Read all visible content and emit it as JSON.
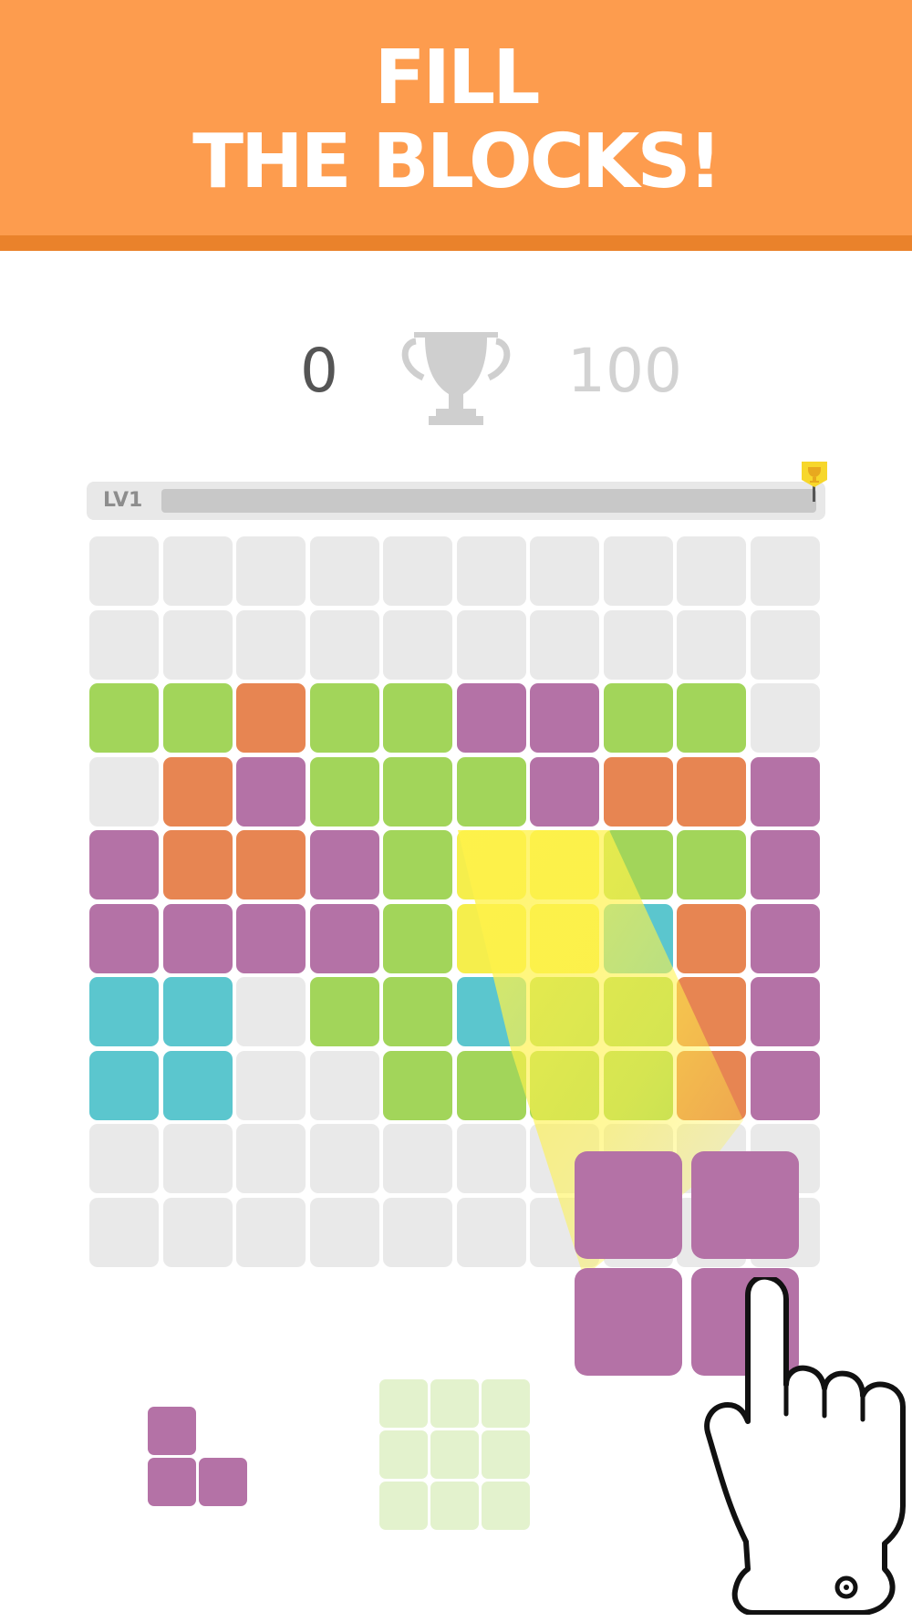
{
  "banner": {
    "title_line1": "FILL",
    "title_line2": "THE BLOCKS!",
    "background": "#fd9c4e",
    "stripe": "#ea822b"
  },
  "score": {
    "current": "0",
    "best": "100",
    "trophy_icon": "trophy-icon"
  },
  "progress": {
    "level_label": "LV1",
    "progress_fraction": 0,
    "goal_icon": "trophy-flag-icon"
  },
  "colors": {
    "empty": "#e9e9e9",
    "green": "#a2d55a",
    "orange": "#e78552",
    "purple": "#b472a6",
    "cyan": "#5bc6ce",
    "highlight": "#f5ee4c",
    "ghost_green": "#e3f2cd"
  },
  "board": {
    "columns": 10,
    "rows": 10,
    "cells": [
      [
        "E",
        "E",
        "E",
        "E",
        "E",
        "E",
        "E",
        "E",
        "E",
        "E"
      ],
      [
        "E",
        "E",
        "E",
        "E",
        "E",
        "E",
        "E",
        "E",
        "E",
        "E"
      ],
      [
        "G",
        "G",
        "O",
        "G",
        "G",
        "P",
        "P",
        "G",
        "G",
        "E"
      ],
      [
        "E",
        "O",
        "P",
        "G",
        "G",
        "G",
        "P",
        "O",
        "O",
        "P"
      ],
      [
        "P",
        "O",
        "O",
        "P",
        "G",
        "Y",
        "Y",
        "G",
        "G",
        "P"
      ],
      [
        "P",
        "P",
        "P",
        "P",
        "G",
        "Y",
        "Y",
        "C",
        "O",
        "P"
      ],
      [
        "C",
        "C",
        "E",
        "G",
        "G",
        "C",
        "G",
        "G",
        "O",
        "P"
      ],
      [
        "C",
        "C",
        "E",
        "E",
        "G",
        "G",
        "G",
        "G",
        "O",
        "P"
      ],
      [
        "E",
        "E",
        "E",
        "E",
        "E",
        "E",
        "E",
        "E",
        "E",
        "E"
      ],
      [
        "E",
        "E",
        "E",
        "E",
        "E",
        "E",
        "E",
        "E",
        "E",
        "E"
      ]
    ]
  },
  "dragging_piece": {
    "shape": "2x2-square",
    "color": "#b472a6"
  },
  "tray": {
    "pieces": [
      {
        "shape": "L-small",
        "color": "#b472a6"
      },
      {
        "shape": "3x3-square",
        "color": "#e3f2cd"
      }
    ]
  },
  "tutorial": {
    "hand_icon": "pointing-hand-icon"
  }
}
